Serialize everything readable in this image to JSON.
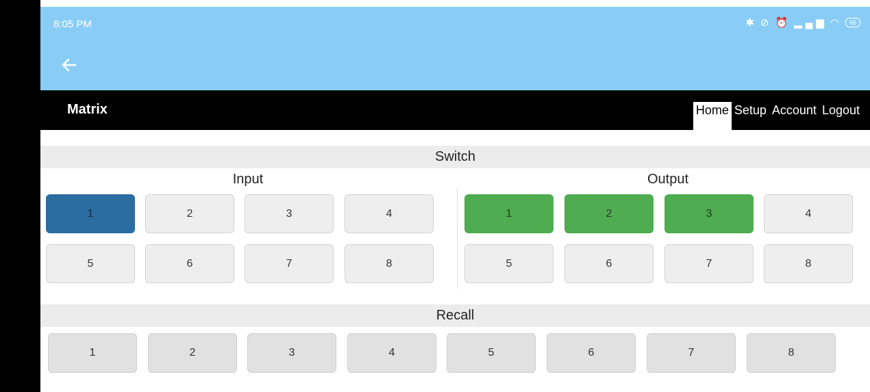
{
  "status_bar": {
    "time": "8:05 PM",
    "icons": [
      "bluetooth-icon",
      "mute-icon",
      "alarm-icon",
      "signal-icon",
      "wifi-icon"
    ],
    "battery": "66",
    "color": "#89cdf6"
  },
  "navbar": {
    "brand": "Matrix",
    "items": [
      {
        "label": "Home",
        "active": true
      },
      {
        "label": "Setup",
        "active": false
      },
      {
        "label": "Account",
        "active": false
      },
      {
        "label": "Logout",
        "active": false
      }
    ]
  },
  "switch": {
    "title": "Switch",
    "input": {
      "title": "Input",
      "buttons": [
        "1",
        "2",
        "3",
        "4",
        "5",
        "6",
        "7",
        "8"
      ],
      "selected": [
        "1"
      ],
      "selected_color": "#2b6ca1"
    },
    "output": {
      "title": "Output",
      "buttons": [
        "1",
        "2",
        "3",
        "4",
        "5",
        "6",
        "7",
        "8"
      ],
      "selected": [
        "1",
        "2",
        "3"
      ],
      "selected_color": "#4fac50"
    }
  },
  "recall": {
    "title": "Recall",
    "buttons": [
      "1",
      "2",
      "3",
      "4",
      "5",
      "6",
      "7",
      "8"
    ]
  }
}
